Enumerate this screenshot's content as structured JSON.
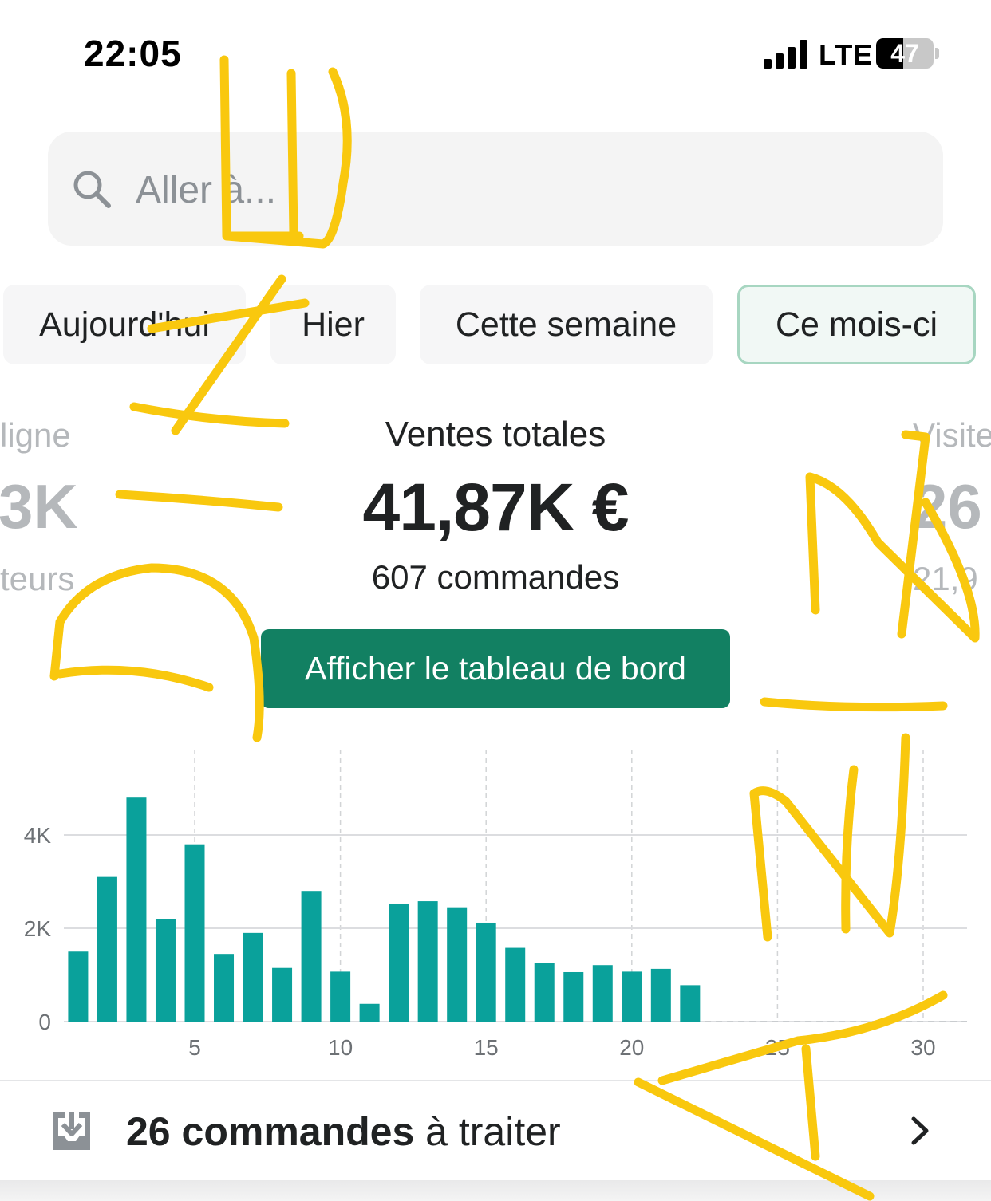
{
  "status_bar": {
    "time": "22:05",
    "network": "LTE",
    "battery": "47"
  },
  "search": {
    "placeholder": "Aller à..."
  },
  "tabs": [
    {
      "label": "Aujourd'hui",
      "active": false
    },
    {
      "label": "Hier",
      "active": false
    },
    {
      "label": "Cette semaine",
      "active": false
    },
    {
      "label": "Ce mois-ci",
      "active": true
    }
  ],
  "metrics": {
    "left": {
      "label": "ligne",
      "value": "3K",
      "sub": "teurs"
    },
    "center": {
      "label": "Ventes totales",
      "value": "41,87K €",
      "sub": "607 commandes"
    },
    "right": {
      "label": "Visite",
      "value": "26",
      "sub": "21,9"
    }
  },
  "dashboard_button": {
    "label": "Afficher le tableau de bord"
  },
  "chart_data": {
    "type": "bar",
    "x": [
      1,
      2,
      3,
      4,
      5,
      6,
      7,
      8,
      9,
      10,
      11,
      12,
      13,
      14,
      15,
      16,
      17,
      18,
      19,
      20,
      21,
      22
    ],
    "values": [
      1500,
      3100,
      4800,
      2200,
      3800,
      1450,
      1900,
      1150,
      2800,
      1070,
      380,
      2530,
      2580,
      2450,
      2120,
      1580,
      1260,
      1060,
      1210,
      1070,
      1130,
      780
    ],
    "x_ticks": [
      "5",
      "10",
      "15",
      "20",
      "25",
      "30"
    ],
    "x_range": [
      1,
      31
    ],
    "y_ticks": [
      "0",
      "2K",
      "4K"
    ],
    "ylim": [
      0,
      5000
    ],
    "color": "#0aa19b",
    "grid": true
  },
  "orders_row": {
    "count": "26 commandes",
    "rest": " à traiter"
  },
  "colors": {
    "accent": "#128062",
    "bar": "#0aa19b",
    "scribble": "#f9c80e"
  }
}
